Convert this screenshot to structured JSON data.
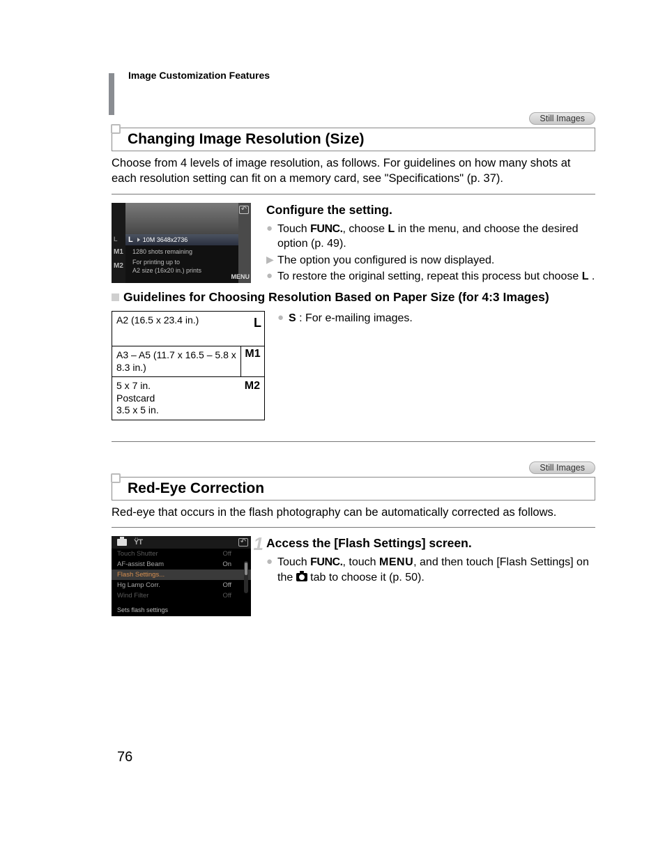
{
  "breadcrumb": "Image Customization Features",
  "category_pill": "Still Images",
  "section1": {
    "title": "Changing Image Resolution (Size)",
    "intro": "Choose from 4 levels of image resolution, as follows. For guidelines on how many shots at each resolution setting can fit on a memory card, see \"Specifications\" (p. 37).",
    "lcd": {
      "hl_badge": "L",
      "hl_text": "10M 3648x2736",
      "m1": "M1",
      "m2": "M2",
      "line1": "1280 shots remaining",
      "line2": "For printing up to",
      "line3": "A2 size (16x20 in.) prints",
      "menu": "MENU"
    },
    "configure": {
      "heading": "Configure the setting.",
      "b1a": "Touch ",
      "func": "FUNC.",
      "b1b": ", choose ",
      "b1_glyph": "L",
      "b1c": " in the menu, and choose the desired option (p. 49).",
      "b2": "The option you configured is now displayed.",
      "b3a": "To restore the original setting, repeat this process but choose ",
      "b3_glyph": "L",
      "b3b": " ."
    },
    "guidelines": {
      "heading": "Guidelines for Choosing Resolution Based on Paper Size (for 4:3 Images)",
      "r1": "A2 (16.5 x 23.4 in.)",
      "r1_badge": "L",
      "r2": "A3 – A5 (11.7 x 16.5 – 5.8 x 8.3 in.)",
      "r2_badge": "M1",
      "r3": "5 x 7 in.\nPostcard\n3.5 x 5 in.",
      "r3_badge": "M2",
      "note_glyph": "S",
      "note_text": " : For e-mailing images."
    }
  },
  "section2": {
    "title": "Red-Eye Correction",
    "intro": "Red-eye that occurs in the flash photography can be automatically corrected as follows.",
    "lcd": {
      "tool": "ŸT",
      "r1k": "Touch Shutter",
      "r1v": "Off",
      "r2k": "AF-assist Beam",
      "r2v": "On",
      "r3k": "Flash Settings...",
      "r4k": "Hg Lamp Corr.",
      "r4v": "Off",
      "r5k": "Wind Filter",
      "r5v": "Off",
      "hint": "Sets flash settings"
    },
    "step": {
      "num": "1",
      "heading": "Access the [Flash Settings] screen.",
      "b1a": "Touch ",
      "func": "FUNC.",
      "b1b": ", touch ",
      "menu": "MENU",
      "b1c": ", and then touch [Flash Settings] on the ",
      "b1d": " tab to choose it (p. 50)."
    }
  },
  "page_number": "76"
}
